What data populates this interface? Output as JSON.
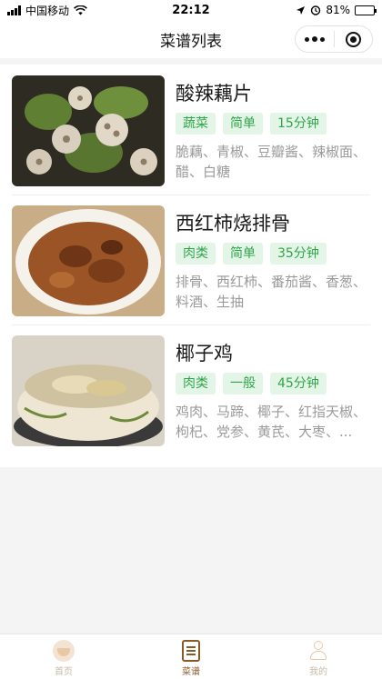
{
  "status_bar": {
    "carrier": "中国移动",
    "time": "22:12",
    "battery": "81%",
    "battery_level": 0.81
  },
  "nav": {
    "title": "菜谱列表"
  },
  "recipes": [
    {
      "name": "酸辣藕片",
      "tags": [
        "蔬菜",
        "简单",
        "15分钟"
      ],
      "ingredients": "脆藕、青椒、豆瓣酱、辣椒面、醋、白糖",
      "image_colors": [
        "#3d3a2a",
        "#6b8a3a"
      ]
    },
    {
      "name": "西红柿烧排骨",
      "tags": [
        "肉类",
        "简单",
        "35分钟"
      ],
      "ingredients": "排骨、西红柿、番茄酱、香葱、料酒、生抽",
      "image_colors": [
        "#8a4a22",
        "#b26a34"
      ]
    },
    {
      "name": "椰子鸡",
      "tags": [
        "肉类",
        "一般",
        "45分钟"
      ],
      "ingredients": "鸡肉、马蹄、椰子、红指天椒、枸杞、党参、黄芪、大枣、...",
      "image_colors": [
        "#d9c49c",
        "#efe1c0"
      ]
    }
  ],
  "tab_bar": {
    "items": [
      {
        "label": "首页",
        "icon": "home-icon",
        "active": false
      },
      {
        "label": "菜谱",
        "icon": "menu-book-icon",
        "active": true
      },
      {
        "label": "我的",
        "icon": "user-icon",
        "active": false
      }
    ]
  },
  "colors": {
    "tag_bg": "#e3f5e7",
    "tag_text": "#31a54a",
    "tab_active": "#8a5a26",
    "tab_inactive": "#c6b9aa"
  }
}
